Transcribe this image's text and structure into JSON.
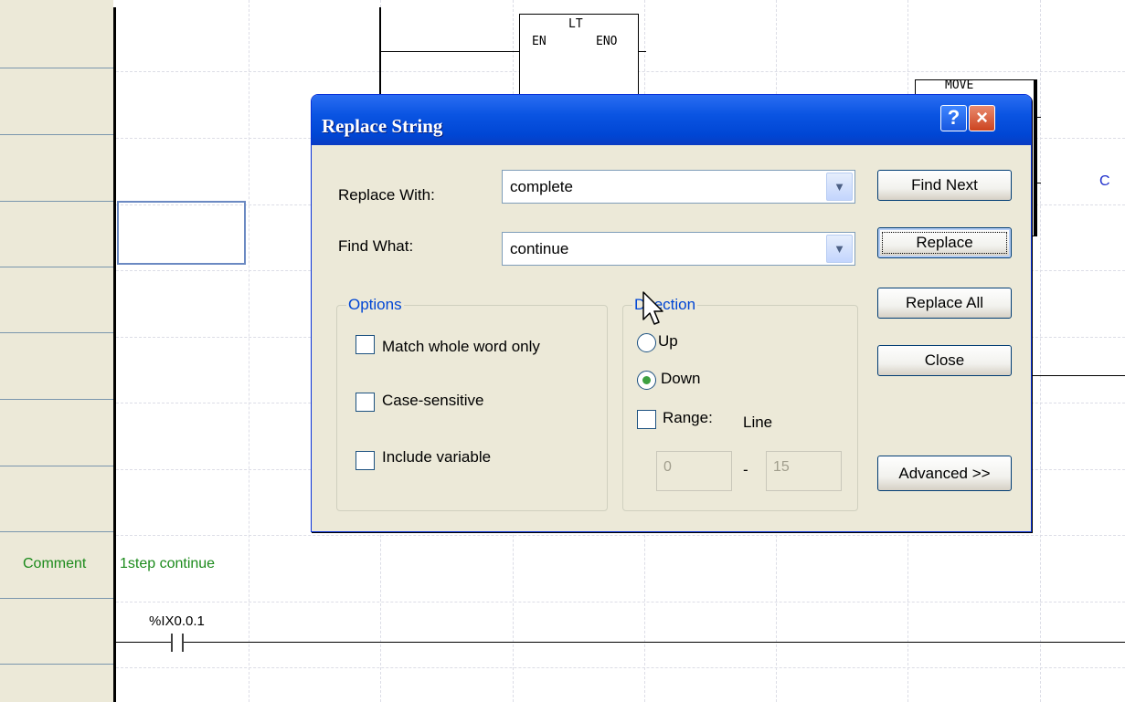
{
  "ladder": {
    "function_block_lt": {
      "name": "LT",
      "en": "EN",
      "eno": "ENO"
    },
    "function_block_move": {
      "name": "MOVE"
    },
    "right_label": "C",
    "comment_label": "Comment",
    "comment_text": "1step continue",
    "contact_variable": "%IX0.0.1"
  },
  "dialog": {
    "title": "Replace String",
    "help_symbol": "?",
    "close_symbol": "×",
    "replace_with": {
      "label": "Replace With:",
      "value": "complete"
    },
    "find_what": {
      "label": "Find What:",
      "value": "continue"
    },
    "options": {
      "legend": "Options",
      "match_whole_word": {
        "label": "Match whole word only",
        "checked": false
      },
      "case_sensitive": {
        "label": "Case-sensitive",
        "checked": false
      },
      "include_variable": {
        "label": "Include variable",
        "checked": false
      }
    },
    "direction": {
      "legend": "Direction",
      "up_label": "Up",
      "down_label": "Down",
      "selected": "Down",
      "range_label": "Range:",
      "range_unit": "Line",
      "range_checked": false,
      "range_from": "0",
      "range_separator": "-",
      "range_to": "15"
    },
    "buttons": {
      "find_next": "Find Next",
      "replace": "Replace",
      "replace_all": "Replace All",
      "close": "Close",
      "advanced": "Advanced >>"
    }
  },
  "colors": {
    "titlebar": "#0a54e2",
    "comment": "#1b8a1b",
    "legend": "#0046d5",
    "gutter": "#ece9d8"
  }
}
